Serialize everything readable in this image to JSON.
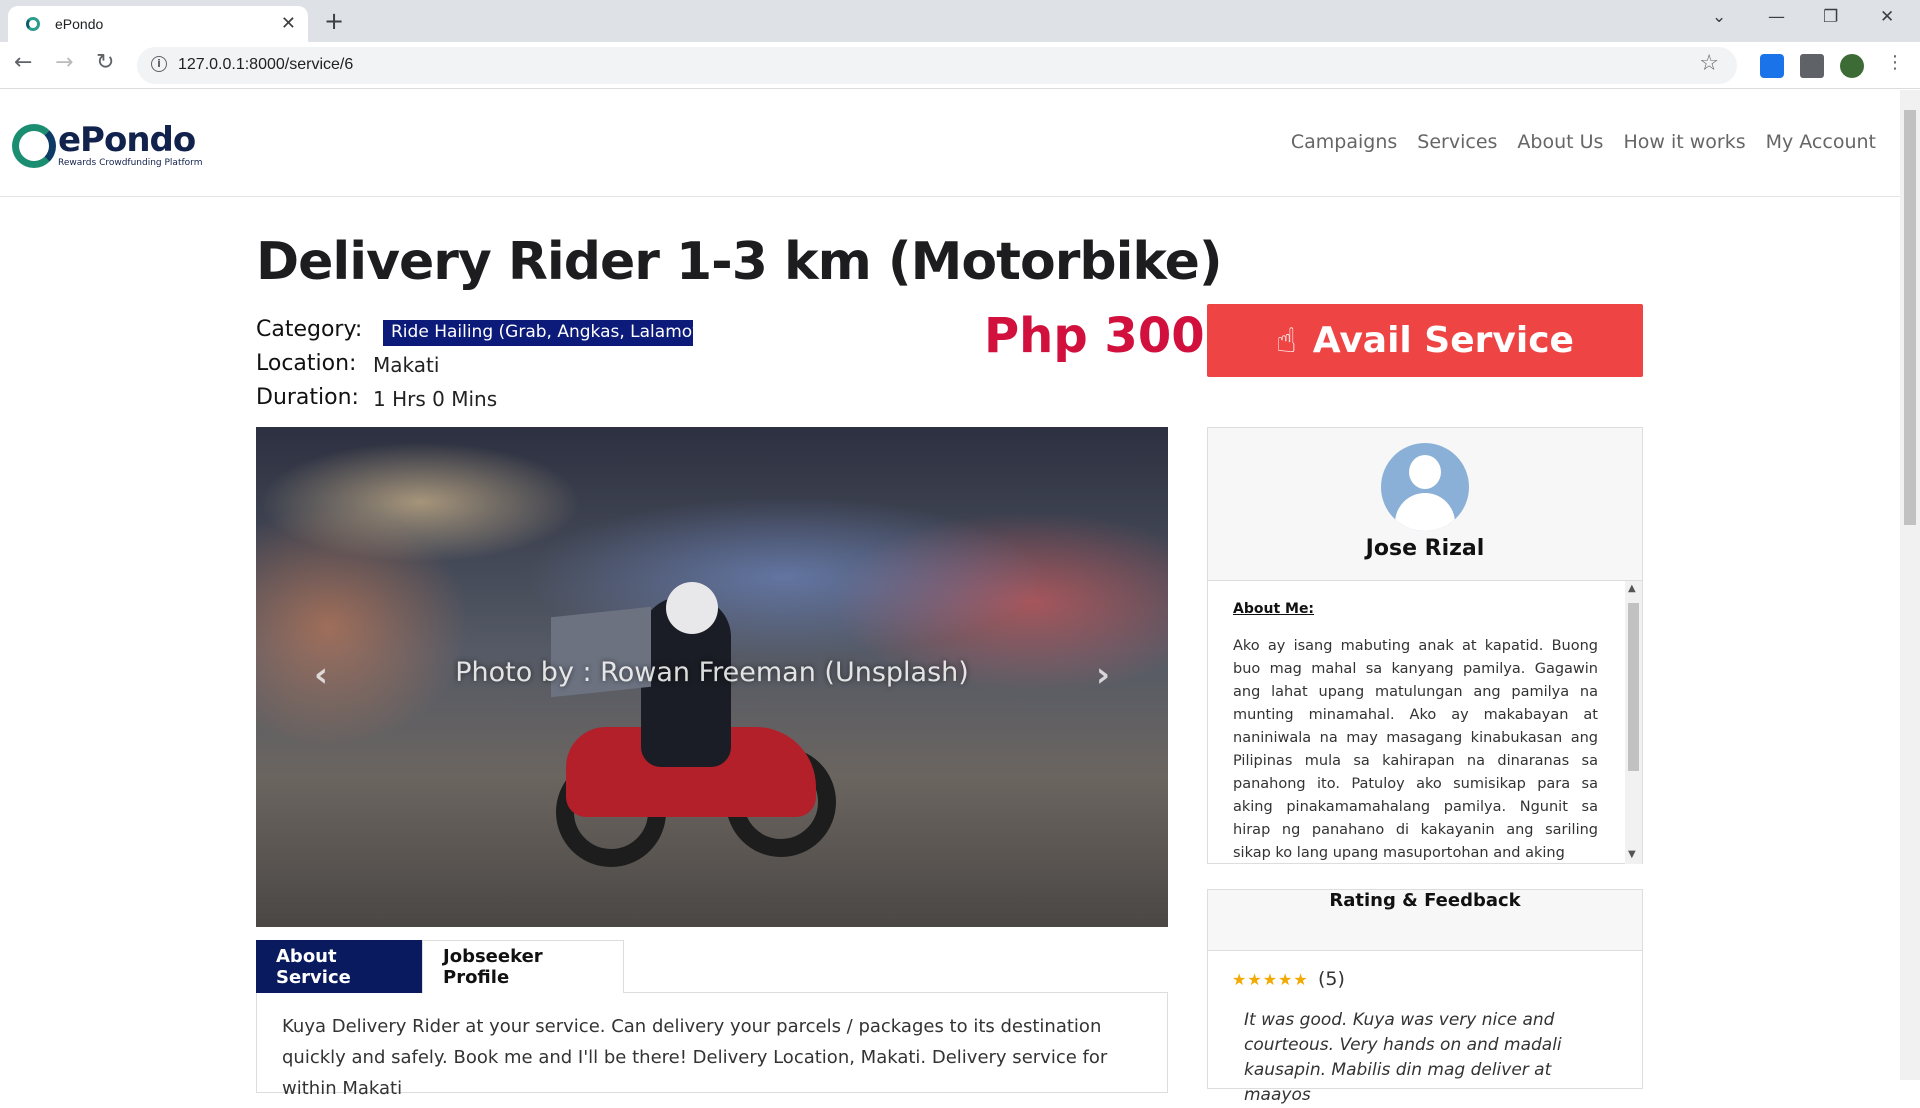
{
  "browser": {
    "tab_title": "ePondo",
    "url": "127.0.0.1:8000/service/6"
  },
  "site": {
    "logo_text": "ePondo",
    "logo_tagline": "Rewards Crowdfunding Platform",
    "nav": [
      "Campaigns",
      "Services",
      "About Us",
      "How it works",
      "My Account"
    ]
  },
  "service": {
    "title": "Delivery Rider 1-3 km (Motorbike)",
    "category_label": "Category:",
    "category": "Ride Hailing (Grab, Angkas, Lalamove)",
    "location_label": "Location:",
    "location": "Makati",
    "duration_label": "Duration:",
    "duration": "1 Hrs 0 Mins",
    "price": "Php 300",
    "avail_label": "Avail Service"
  },
  "carousel": {
    "caption": "Photo by : Rowan Freeman (Unsplash)"
  },
  "tabs": {
    "active": "About Service",
    "inactive": "Jobseeker Profile",
    "about_text": "Kuya Delivery Rider at your service. Can delivery your parcels / packages to its destination quickly and safely. Book me and I'll be there! Delivery Location, Makati. Delivery service for within Makati"
  },
  "profile": {
    "name": "Jose Rizal",
    "about_label": "About Me:",
    "about_text": "Ako ay isang mabuting anak at kapatid. Buong buo mag mahal sa kanyang pamilya. Gagawin ang lahat upang matulungan ang pamilya na munting minamahal. Ako ay makabayan at naniniwala na may masagang kinabukasan ang Pilipinas mula sa kahirapan na dinaranas sa panahong ito. Patuloy ako sumisikap para sa aking pinakamamahalang pamilya. Ngunit sa hirap ng panahano di kakayanin ang sariling sikap ko lang upang masuportohan and aking"
  },
  "rating": {
    "header": "Rating & Feedback",
    "stars": 5,
    "count": "(5)",
    "feedback": "It was good. Kuya was very nice and courteous. Very hands on and madali kausapin. Mabilis din mag deliver at maayos"
  },
  "colors": {
    "brand_navy": "#0a1a5e",
    "price_red": "#d1103d",
    "avail_button": "#ee4444",
    "category_badge": "#0c1a7a"
  }
}
